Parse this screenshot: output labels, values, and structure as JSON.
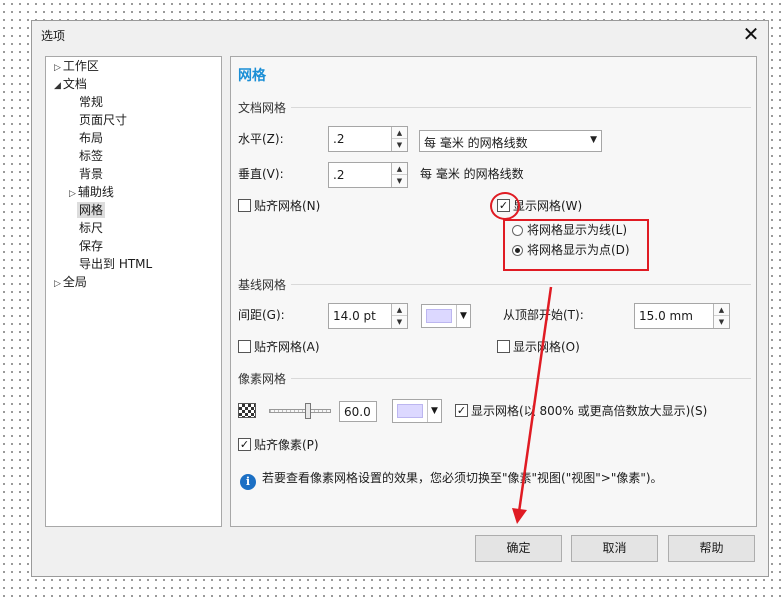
{
  "window": {
    "title": "选项"
  },
  "tree": {
    "items": [
      {
        "label": "工作区",
        "expander": "▷"
      },
      {
        "label": "文档",
        "expander": "◢"
      },
      {
        "label": "常规",
        "expander": ""
      },
      {
        "label": "页面尺寸",
        "expander": ""
      },
      {
        "label": "布局",
        "expander": ""
      },
      {
        "label": "标签",
        "expander": ""
      },
      {
        "label": "背景",
        "expander": ""
      },
      {
        "label": "辅助线",
        "expander": "▷"
      },
      {
        "label": "网格",
        "expander": ""
      },
      {
        "label": "标尺",
        "expander": ""
      },
      {
        "label": "保存",
        "expander": ""
      },
      {
        "label": "导出到 HTML",
        "expander": ""
      },
      {
        "label": "全局",
        "expander": "▷"
      }
    ],
    "selected": "网格"
  },
  "panel": {
    "title": "网格",
    "doc_grid": {
      "section": "文档网格",
      "horizontal_label": "水平(Z):",
      "horizontal_value": ".2",
      "vertical_label": "垂直(V):",
      "vertical_value": ".2",
      "units_select": "每 毫米 的网格线数",
      "units_text": "每 毫米 的网格线数",
      "snap_label": "贴齐网格(N)",
      "show_label": "显示网格(W)",
      "show_checked": true,
      "as_lines_label": "将网格显示为线(L)",
      "as_dots_label": "将网格显示为点(D)",
      "as_dots_selected": true
    },
    "baseline_grid": {
      "section": "基线网格",
      "spacing_label": "间距(G):",
      "spacing_value": "14.0 pt",
      "from_top_label": "从顶部开始(T):",
      "from_top_value": "15.0 mm",
      "snap_label": "贴齐网格(A)",
      "show_label": "显示网格(O)",
      "color": "#dcd8ff"
    },
    "pixel_grid": {
      "section": "像素网格",
      "opacity_value": "60.0",
      "color": "#dcd8ff",
      "show_label": "显示网格(以 800% 或更高倍数放大显示)(S)",
      "show_checked": true,
      "snap_pixels_label": "贴齐像素(P)",
      "snap_pixels_checked": true,
      "info_text": "若要查看像素网格设置的效果，您必须切换至\"像素\"视图(\"视图\">\"像素\")。"
    }
  },
  "buttons": {
    "ok": "确定",
    "cancel": "取消",
    "help": "帮助"
  },
  "icons": {
    "close": "✕",
    "check": "✓",
    "info": "i",
    "spin_up": "▲",
    "spin_down": "▼",
    "dropdown": "▼"
  },
  "colors": {
    "accent": "#1b8fd6",
    "annotation": "#e01b23"
  }
}
